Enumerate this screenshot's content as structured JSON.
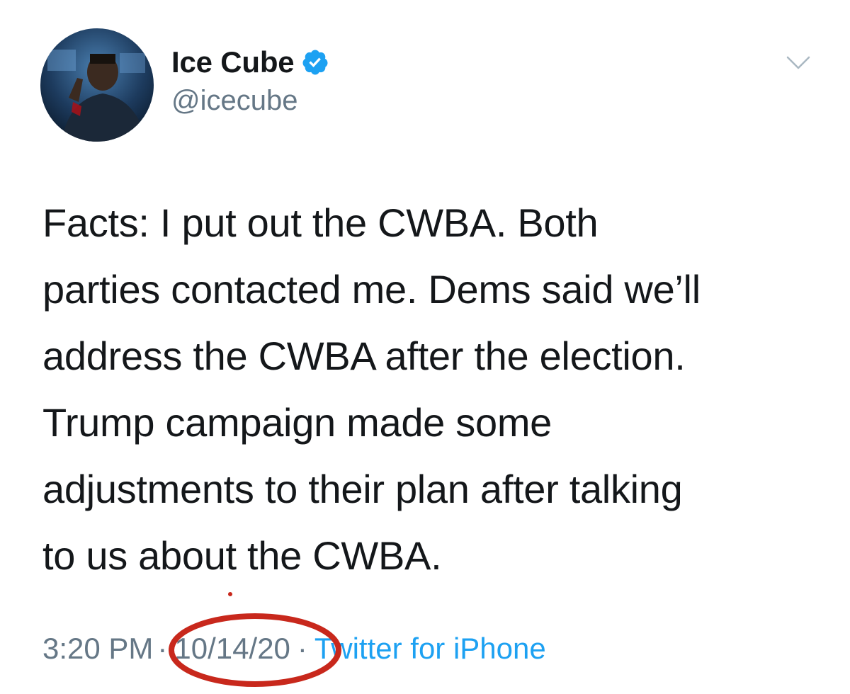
{
  "author": {
    "display_name": "Ice Cube",
    "handle": "@icecube",
    "verified": true
  },
  "tweet": {
    "text": "Facts: I put out the CWBA. Both\nparties contacted me. Dems said we’ll\naddress the CWBA after the election.\nTrump campaign made some\nadjustments to their plan after talking\nto us about the CWBA."
  },
  "meta": {
    "time": "3:20 PM",
    "separator": "·",
    "date": "10/14/20",
    "source": "Twitter for iPhone"
  },
  "icons": {
    "verified": "verified-badge-icon",
    "menu": "chevron-down-icon"
  },
  "colors": {
    "verified_blue": "#1da1f2",
    "link_blue": "#1da1f2",
    "muted_text": "#657786",
    "annotation_red": "#c8281c"
  }
}
